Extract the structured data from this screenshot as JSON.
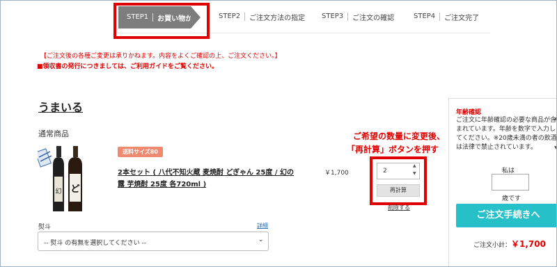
{
  "steps": [
    {
      "num": "STEP1",
      "label": "お買い物かご"
    },
    {
      "num": "STEP2",
      "label": "ご注文方法の指定"
    },
    {
      "num": "STEP3",
      "label": "ご注文の確認"
    },
    {
      "num": "STEP4",
      "label": "ご注文完了"
    }
  ],
  "notices": {
    "line1": "【ご注文後の各種ご変更は承りかねます。内容をよくご確認の上、ご注文ください。】",
    "line2": "■領収書の発行につきましては、ご利用ガイドをご覧ください。"
  },
  "shop": {
    "name": "うまいる",
    "section": "通常商品"
  },
  "product": {
    "badge": "送料サイズ80",
    "name": "2本セット ( 八代不知火蔵 麦焼酎 どぎゃん 25度 / 幻の露 芋焼酎 25度 各720ml )",
    "price": "￥1,700",
    "quantity": "2",
    "recalc_label": "再計算",
    "delete_label": "削除する"
  },
  "callout": {
    "line1": "ご希望の数量に変更後、",
    "line2": "「再計算」ボタンを押す"
  },
  "noshi": {
    "label": "熨斗",
    "detail_link": "詳細",
    "selected": "-- 熨斗 の有無を選択してください --"
  },
  "age_check": {
    "title": "年齢確認",
    "text": "ご注文に年齢確認の必要な商品が含まれています。年齢を数字で入力してください。※20歳未満の者の飲酒は法律で禁止されています。",
    "prefix": "私は",
    "suffix": "歳です"
  },
  "checkout": {
    "button_label": "ご注文手続きへ",
    "subtotal_label": "ご注文小計：",
    "subtotal_value": "￥1,700"
  },
  "colors": {
    "accent_red": "#e00000",
    "checkout_teal": "#25c0c8",
    "step_active": "#7d7d7d"
  }
}
